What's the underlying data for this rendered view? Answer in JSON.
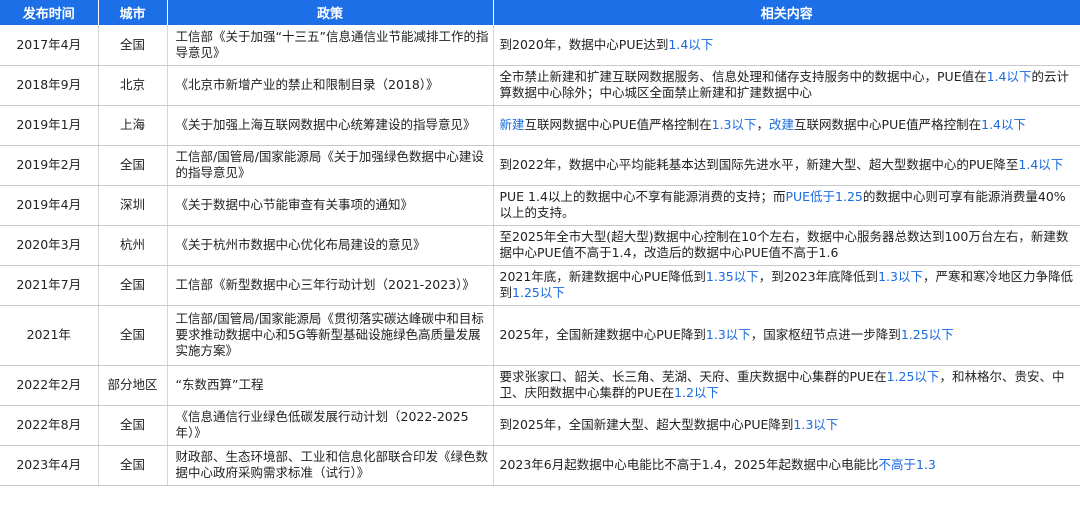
{
  "headers": {
    "date": "发布时间",
    "city": "城市",
    "policy": "政策",
    "content": "相关内容"
  },
  "colors": {
    "header_bg": "#1c6fe6",
    "highlight": "#1a6be0",
    "row_line": "#c9c9c9"
  },
  "rows": [
    {
      "date": "2017年4月",
      "city": "全国",
      "policy": "工信部《关于加强“十三五”信息通信业节能减排工作的指导意见》",
      "content": [
        {
          "t": "到2020年，数据中心PUE达到",
          "hl": false
        },
        {
          "t": "1.4以下",
          "hl": true
        }
      ]
    },
    {
      "date": "2018年9月",
      "city": "北京",
      "policy": "《北京市新增产业的禁止和限制目录（2018）》",
      "content": [
        {
          "t": "全市禁止新建和扩建互联网数据服务、信息处理和储存支持服务中的数据中心，PUE值在",
          "hl": false
        },
        {
          "t": "1.4以下",
          "hl": true
        },
        {
          "t": "的云计算数据中心除外；中心城区全面禁止新建和扩建数据中心",
          "hl": false
        }
      ]
    },
    {
      "date": "2019年1月",
      "city": "上海",
      "policy": "《关于加强上海互联网数据中心统筹建设的指导意见》",
      "content": [
        {
          "t": "新建",
          "hl": true
        },
        {
          "t": "互联网数据中心PUE值严格控制在",
          "hl": false
        },
        {
          "t": "1.3以下",
          "hl": true
        },
        {
          "t": "，",
          "hl": false
        },
        {
          "t": "改建",
          "hl": true
        },
        {
          "t": "互联网数据中心PUE值严格控制在",
          "hl": false
        },
        {
          "t": "1.4以下",
          "hl": true
        }
      ]
    },
    {
      "date": "2019年2月",
      "city": "全国",
      "policy": "工信部/国管局/国家能源局《关于加强绿色数据中心建设的指导意见》",
      "content": [
        {
          "t": "到2022年，数据中心平均能耗基本达到国际先进水平，新建大型、超大型数据中心的PUE降至",
          "hl": false
        },
        {
          "t": "1.4以下",
          "hl": true
        }
      ]
    },
    {
      "date": "2019年4月",
      "city": "深圳",
      "policy": "《关于数据中心节能审查有关事项的通知》",
      "content": [
        {
          "t": "PUE 1.4以上的数据中心不享有能源消费的支持；而",
          "hl": false
        },
        {
          "t": "PUE低于1.25",
          "hl": true
        },
        {
          "t": "的数据中心则可享有能源消费量40%以上的支持。",
          "hl": false
        }
      ]
    },
    {
      "date": "2020年3月",
      "city": "杭州",
      "policy": "《关于杭州市数据中心优化布局建设的意见》",
      "content": [
        {
          "t": "至2025年全市大型(超大型)数据中心控制在10个左右，数据中心服务器总数达到100万台左右，新建数据中心PUE值不高于1.4，改造后的数据中心PUE值不高于1.6",
          "hl": false
        }
      ]
    },
    {
      "date": "2021年7月",
      "city": "全国",
      "policy": "工信部《新型数据中心三年行动计划（2021-2023）》",
      "content": [
        {
          "t": "2021年底，新建数据中心PUE降低到",
          "hl": false
        },
        {
          "t": "1.35以下",
          "hl": true
        },
        {
          "t": "，到2023年底降低到",
          "hl": false
        },
        {
          "t": "1.3以下",
          "hl": true
        },
        {
          "t": "，严寒和寒冷地区力争降低到",
          "hl": false
        },
        {
          "t": "1.25以下",
          "hl": true
        }
      ]
    },
    {
      "date": "2021年",
      "city": "全国",
      "policy": "工信部/国管局/国家能源局《贯彻落实碳达峰碳中和目标要求推动数据中心和5G等新型基础设施绿色高质量发展实施方案》",
      "content": [
        {
          "t": "2025年，全国新建数据中心PUE降到",
          "hl": false
        },
        {
          "t": "1.3以下",
          "hl": true
        },
        {
          "t": "，国家枢纽节点进一步降到",
          "hl": false
        },
        {
          "t": "1.25以下",
          "hl": true
        }
      ]
    },
    {
      "date": "2022年2月",
      "city": "部分地区",
      "policy": "“东数西算”工程",
      "content": [
        {
          "t": "要求张家口、韶关、长三角、芜湖、天府、重庆数据中心集群的PUE在",
          "hl": false
        },
        {
          "t": "1.25以下",
          "hl": true
        },
        {
          "t": "，和林格尔、贵安、中卫、庆阳数据中心集群的PUE在",
          "hl": false
        },
        {
          "t": "1.2以下",
          "hl": true
        }
      ]
    },
    {
      "date": "2022年8月",
      "city": "全国",
      "policy": "《信息通信行业绿色低碳发展行动计划（2022-2025年）》",
      "content": [
        {
          "t": "到2025年，全国新建大型、超大型数据中心PUE降到",
          "hl": false
        },
        {
          "t": "1.3以下",
          "hl": true
        }
      ]
    },
    {
      "date": "2023年4月",
      "city": "全国",
      "policy": "财政部、生态环境部、工业和信息化部联合印发《绿色数据中心政府采购需求标准（试行）》",
      "content": [
        {
          "t": "2023年6月起数据中心电能比不高于1.4，2025年起数据中心电能比",
          "hl": false
        },
        {
          "t": "不高于1.3",
          "hl": true
        }
      ]
    }
  ]
}
